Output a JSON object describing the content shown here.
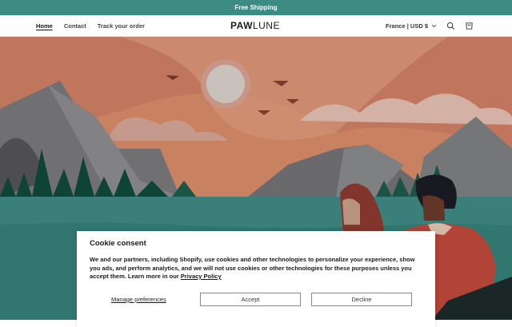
{
  "announcement": "Free Shipping",
  "nav": {
    "home": "Home",
    "contact": "Contact",
    "track": "Track your order"
  },
  "logo": {
    "part1": "PAW",
    "part2": "LUNE"
  },
  "header_right": {
    "locale": "France | USD $"
  },
  "icons": {
    "search": "search-icon",
    "cart": "cart-icon",
    "chevron": "chevron-down-icon"
  },
  "hero": {
    "description": "illustrated landscape"
  },
  "cookie": {
    "title": "Cookie consent",
    "body": "We and our partners, including Shopify, use cookies and other technologies to personalize your experience, show you ads, and perform analytics, and we will not use cookies or other technologies for these purposes unless you accept them. Learn more in our ",
    "policy_link": "Privacy Policy",
    "manage": "Manage preferences",
    "accept": "Accept",
    "decline": "Decline"
  },
  "colors": {
    "announce_bg": "#3d8c84",
    "sky": "#d98c6a",
    "water": "#3f8a84"
  }
}
